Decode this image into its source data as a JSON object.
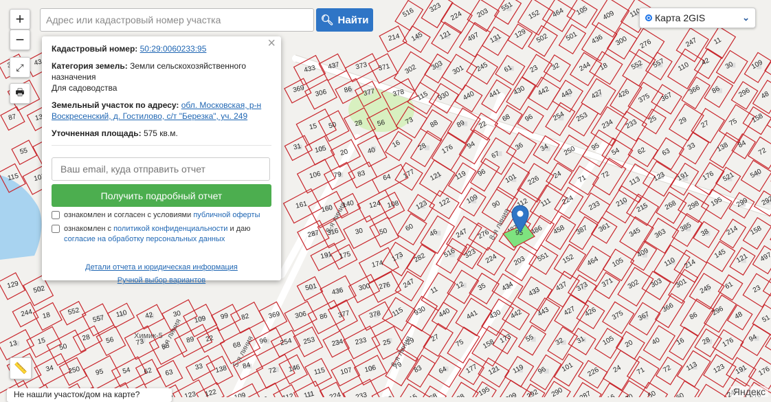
{
  "search": {
    "placeholder": "Адрес или кадастровый номер участка",
    "button_label": "Найти"
  },
  "zoom": {
    "in": "+",
    "out": "−"
  },
  "layer": {
    "selected": "Карта 2GIS"
  },
  "popup": {
    "cad_label": "Кадастровый номер:",
    "cad_number": "50:29:0060233:95",
    "category_label": "Категория земель:",
    "category_value": "Земли сельскохозяйственного назначения",
    "usage": "Для садоводства",
    "address_label": "Земельный участок по адресу:",
    "address_value": "обл. Московская, р-н Воскресенский, д. Гостилово, с/т \"Березка\", уч. 249",
    "area_label": "Уточненная площадь:",
    "area_value": "575 кв.м.",
    "email_placeholder": "Ваш email, куда отправить отчет",
    "report_button": "Получить подробный отчет",
    "check1_pre": "ознакомлен и согласен с условиями ",
    "check1_link": "публичной оферты",
    "check2_pre": "ознакомлен с ",
    "check2_link": "политикой конфиденциальности",
    "check2_mid": " и даю ",
    "check2_link2": "согласие на обработку персональных данных",
    "details_link": "Детали отчета и юридическая информация",
    "manual_link": "Ручной выбор вариантов"
  },
  "bottom_tip": "Не нашли участок/дом на карте?",
  "attribution": "Яндекс",
  "map": {
    "streets": [
      "8-я линия",
      "8-я линия",
      "6-я линия",
      "4-я линия",
      "5-я линия",
      "Химик-5"
    ],
    "parcels": [
      "516",
      "323",
      "224",
      "203",
      "551",
      "152",
      "464",
      "105",
      "409",
      "110",
      "214",
      "145",
      "121",
      "497",
      "131",
      "129",
      "502",
      "501",
      "436",
      "300",
      "276",
      "247",
      "11",
      "12",
      "35",
      "434",
      "433",
      "437",
      "373",
      "371",
      "302",
      "303",
      "301",
      "245",
      "61",
      "23",
      "32",
      "244",
      "18",
      "552",
      "557",
      "110",
      "42",
      "30",
      "109",
      "99",
      "82",
      "369",
      "306",
      "86",
      "377",
      "378",
      "115",
      "930",
      "440",
      "441",
      "430",
      "442",
      "443",
      "427",
      "426",
      "375",
      "367",
      "366",
      "86",
      "296",
      "48",
      "51",
      "87",
      "13",
      "15",
      "50",
      "28",
      "56",
      "73",
      "88",
      "89",
      "22",
      "68",
      "96",
      "254",
      "253",
      "234",
      "233",
      "25",
      "29",
      "27",
      "75",
      "158",
      "173",
      "55",
      "32",
      "31",
      "105",
      "20",
      "40",
      "16",
      "28",
      "176",
      "94",
      "67",
      "36",
      "34",
      "250",
      "95",
      "54",
      "62",
      "63",
      "33",
      "138",
      "84",
      "72",
      "146",
      "115",
      "107",
      "106",
      "79",
      "83",
      "64",
      "177",
      "121",
      "119",
      "96",
      "101",
      "226",
      "24",
      "71",
      "72",
      "113",
      "123",
      "191",
      "176",
      "521",
      "540",
      "303",
      "161",
      "160",
      "140",
      "124",
      "108",
      "123",
      "122",
      "109",
      "90",
      "112",
      "111",
      "224",
      "233",
      "210",
      "215",
      "268",
      "298",
      "195",
      "299",
      "292",
      "290",
      "287",
      "316",
      "30",
      "50",
      "60",
      "46",
      "247",
      "276",
      "487",
      "486",
      "458",
      "387",
      "361",
      "345",
      "363",
      "385",
      "38",
      "214",
      "158",
      "176",
      "191",
      "175",
      "174",
      "173",
      "282"
    ],
    "selected_label": "95"
  }
}
